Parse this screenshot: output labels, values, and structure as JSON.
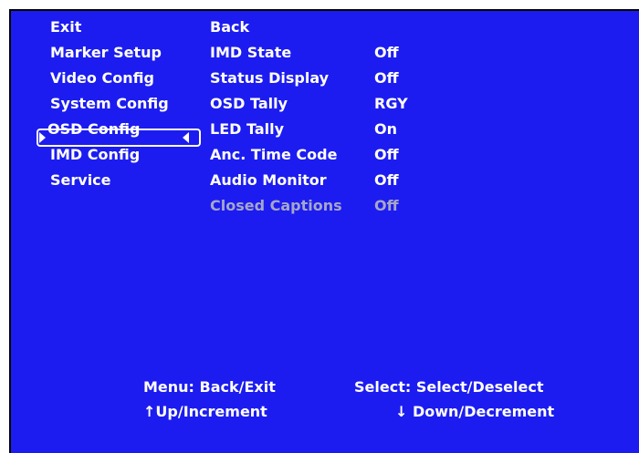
{
  "colors": {
    "background": "#1c1cf0",
    "text": "#ffffff",
    "disabled_text": "#a6a6c8"
  },
  "main_menu": {
    "items": [
      {
        "label": "Exit"
      },
      {
        "label": "Marker Setup"
      },
      {
        "label": "Video Config"
      },
      {
        "label": "System Config"
      },
      {
        "label": "OSD Config",
        "selected": true
      },
      {
        "label": "IMD Config"
      },
      {
        "label": "Service"
      }
    ]
  },
  "sub_menu": {
    "items": [
      {
        "label": "Back",
        "value": ""
      },
      {
        "label": "IMD State",
        "value": "Off"
      },
      {
        "label": "Status Display",
        "value": "Off"
      },
      {
        "label": "OSD Tally",
        "value": "RGY"
      },
      {
        "label": "LED Tally",
        "value": "On"
      },
      {
        "label": "Anc. Time Code",
        "value": "Off"
      },
      {
        "label": "Audio Monitor",
        "value": "Off"
      },
      {
        "label": "Closed Captions",
        "value": "Off",
        "disabled": true
      }
    ]
  },
  "help": {
    "menu": "Menu: Back/Exit",
    "select": "Select: Select/Deselect",
    "up": "↑Up/Increment",
    "down": "↓ Down/Decrement"
  }
}
